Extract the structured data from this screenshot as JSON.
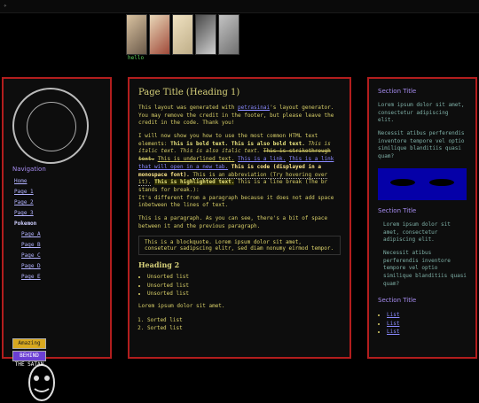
{
  "header": {
    "tagline": "hello"
  },
  "center": {
    "title": "Page Title (Heading 1)",
    "intro_pre": "This layout was generated with ",
    "intro_link": "petrasinai",
    "intro_post": "'s layout generator. You may remove the credit in the footer, but please leave the credit in the code. Thank you!",
    "p2": {
      "a": "I will now show you how to use the most common HTML text elements: ",
      "b1": "This is bold text.",
      "b2": "This is also bold text.",
      "i1": "This is italic text.",
      "i2": "This is also italic text.",
      "strike": "This is strikethrough text.",
      "under": "This is underlined text.",
      "link1": "This is a link.",
      "link2": "This is a link that will open in a new tab.",
      "code": "This is code (displayed in a monospace font).",
      "abbr": "This is an abbreviation (Try hovering over it).",
      "hl": "This is highlighted text.",
      "br": "This is a line break (The br stands for break.):",
      "p3": "It's different from a paragraph because it does not add space inbetween the lines of text."
    },
    "p4": "This is a paragraph. As you can see, there's a bit of space between it and the previous paragraph.",
    "quote": "This is a blockquote. Lorem ipsum dolor sit amet, consetetur sadipscing elitr, sed diam nonumy eirmod tempor.",
    "h2": "Heading 2",
    "ul": [
      "Unsorted list",
      "Unsorted list",
      "Unsorted list"
    ],
    "p5": "Lorem ipsum dolor sit amet.",
    "ol": [
      "Sorted list",
      "Sorted list"
    ]
  },
  "left": {
    "nav_title": "Navigation",
    "items": [
      "Home",
      "Page 1",
      "Page 2",
      "Page 3",
      "Pokemon",
      "Page A",
      "Page B",
      "Page C",
      "Page D",
      "Page E"
    ],
    "badges": [
      "Amazing free stuff",
      "BEHIND THE SATAN"
    ]
  },
  "right": {
    "sections": [
      {
        "title": "Section Title",
        "p1": "Lorem ipsum dolor sit amet, consectetur adipiscing elit.",
        "p2": "Necessit atibus perferendis inventore tempore vel optio similique blanditiis quasi quam?"
      },
      {
        "title": "Section Title",
        "p1": "Lorem ipsum dolor sit amet, consectetur adipiscing elit.",
        "p2": "Necessit atibus perferendis inventore tempore vel optio similique blanditiis quasi quam?"
      },
      {
        "title": "Section Title",
        "list": [
          "List",
          "List",
          "List"
        ]
      }
    ]
  }
}
